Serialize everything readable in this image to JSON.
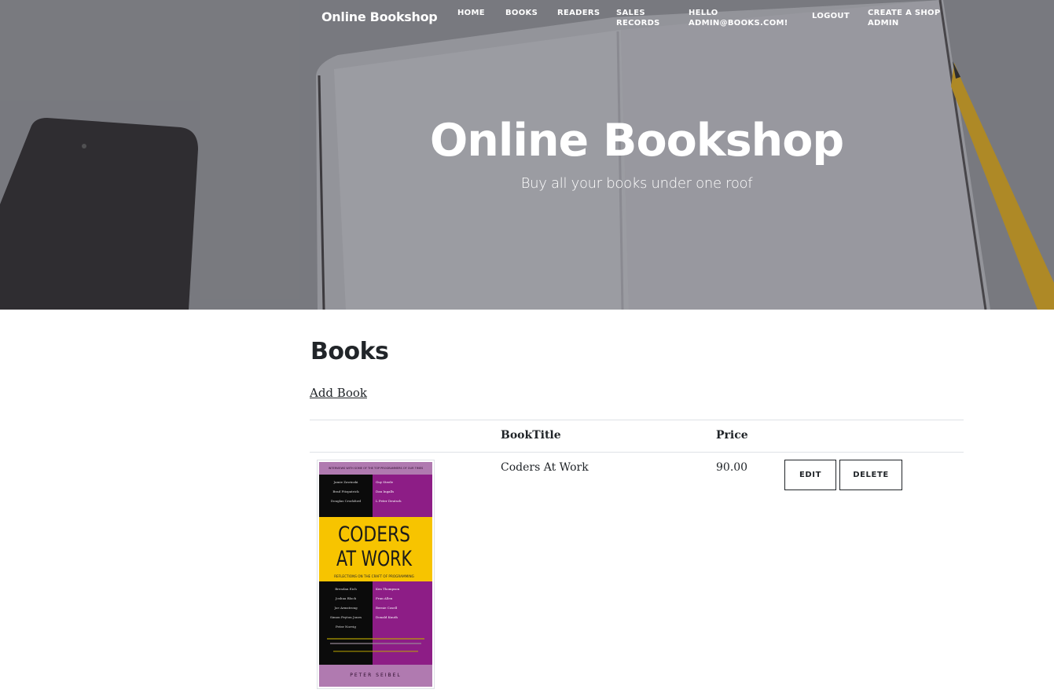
{
  "nav": {
    "brand": "Online Bookshop",
    "links": [
      "Home",
      "Books",
      "Readers",
      "Sales Records",
      "Hello admin@books.com!",
      "Logout",
      "Create A Shop Admin"
    ]
  },
  "hero": {
    "title": "Online Bookshop",
    "subtitle": "Buy all your books under one roof"
  },
  "page": {
    "title": "Books",
    "add_link": "Add Book"
  },
  "table": {
    "headers": [
      "",
      "BookTitle",
      "Price",
      ""
    ],
    "rows": [
      {
        "title": "Coders At Work",
        "price": "90.00",
        "edit_label": "Edit",
        "delete_label": "Delete",
        "cover": {
          "top_banner": "INTERVIEWS WITH SOME OF THE TOP PROGRAMMERS OF OUR TIMES",
          "names_top": [
            "Jamie Zawinski",
            "Guy Steele",
            "Brad Fitzpatrick",
            "Dan Ingalls",
            "Douglas Crockford",
            "L Peter Deutsch"
          ],
          "title_line1": "CODERS",
          "title_line2": "AT WORK",
          "tagline": "REFLECTIONS ON THE CRAFT OF PROGRAMMING",
          "names_bottom": [
            "Brendan Eich",
            "Ken Thompson",
            "Joshua Bloch",
            "Fran Allen",
            "Joe Armstrong",
            "Bernie Cosell",
            "Simon Peyton Jones",
            "Donald Knuth",
            "Peter Norvig"
          ],
          "author": "PETER SEIBEL"
        }
      }
    ]
  },
  "colors": {
    "cover_purple": "#8d1d86",
    "cover_yellow": "#f7c400",
    "cover_black": "#0b0b0b",
    "cover_lilac": "#b07ab0"
  }
}
